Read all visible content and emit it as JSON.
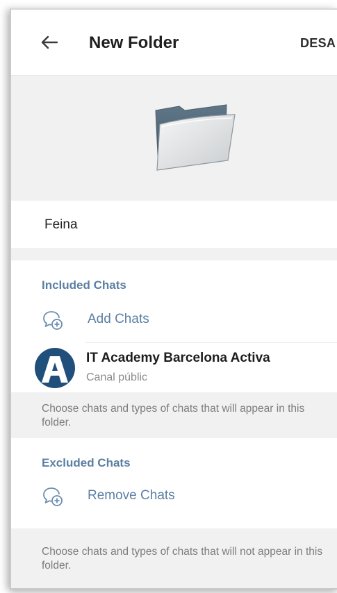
{
  "header": {
    "title": "New Folder",
    "save_label": "DESA"
  },
  "folder": {
    "name": "Feina"
  },
  "included": {
    "section_title": "Included Chats",
    "add_label": "Add Chats",
    "chats": [
      {
        "name": "IT Academy Barcelona Activa",
        "subtitle": "Canal públic"
      }
    ],
    "info": "Choose chats and types of chats that will appear in this folder."
  },
  "excluded": {
    "section_title": "Excluded Chats",
    "remove_label": "Remove Chats",
    "info": "Choose chats and types of chats that will not appear in this folder."
  },
  "colors": {
    "accent": "#5b7fa3",
    "avatar": "#1f4f7a",
    "background_gray": "#f1f1f1"
  }
}
